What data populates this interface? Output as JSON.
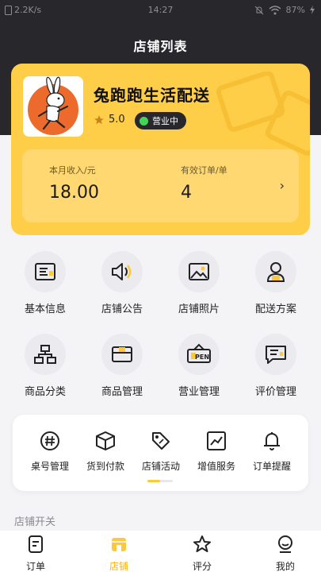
{
  "status": {
    "speed": "2.2K/s",
    "time": "14:27",
    "battery": "87%"
  },
  "title": "店铺列表",
  "store": {
    "name": "兔跑跑生活配送",
    "rating": "5.0",
    "status_badge": "营业中",
    "stats": [
      {
        "label": "本月收入/元",
        "value": "18.00"
      },
      {
        "label": "有效订单/单",
        "value": "4"
      }
    ],
    "arrow": "›"
  },
  "grid": [
    {
      "label": "基本信息",
      "icon": "info-card-icon"
    },
    {
      "label": "店铺公告",
      "icon": "speaker-icon"
    },
    {
      "label": "店铺照片",
      "icon": "image-icon"
    },
    {
      "label": "配送方案",
      "icon": "courier-icon"
    },
    {
      "label": "商品分类",
      "icon": "category-tree-icon"
    },
    {
      "label": "商品管理",
      "icon": "product-box-icon"
    },
    {
      "label": "营业管理",
      "icon": "open-sign-icon"
    },
    {
      "label": "评价管理",
      "icon": "comment-icon"
    }
  ],
  "tools": [
    {
      "label": "桌号管理",
      "icon": "hash-icon"
    },
    {
      "label": "货到付款",
      "icon": "package-icon"
    },
    {
      "label": "店铺活动",
      "icon": "tag-icon"
    },
    {
      "label": "增值服务",
      "icon": "trend-icon"
    },
    {
      "label": "订单提醒",
      "icon": "bell-icon"
    }
  ],
  "section_title": "店铺开关",
  "tabs": [
    {
      "label": "订单",
      "icon": "order-icon",
      "active": false
    },
    {
      "label": "店铺",
      "icon": "store-icon",
      "active": true
    },
    {
      "label": "评分",
      "icon": "star-icon",
      "active": false
    },
    {
      "label": "我的",
      "icon": "profile-icon",
      "active": false
    }
  ],
  "colors": {
    "accent": "#ffce49",
    "dark": "#27272c",
    "active_tab": "#ffb300",
    "badge_dot": "#44d35a"
  }
}
